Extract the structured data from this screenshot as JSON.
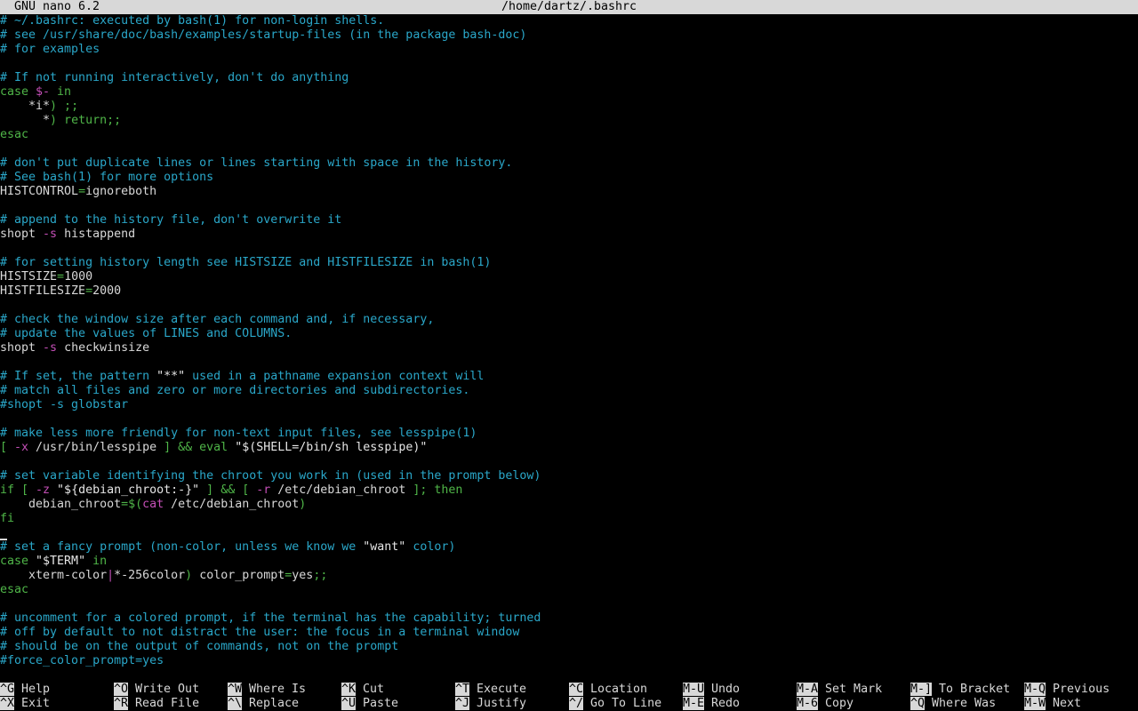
{
  "title": {
    "app": "GNU nano 6.2",
    "file": "/home/dartz/.bashrc"
  },
  "lines": [
    [
      {
        "t": "# ~/.bashrc: executed by bash(1) for non-login shells.",
        "c": "comment"
      }
    ],
    [
      {
        "t": "# see /usr/share/doc/bash/examples/startup-files (in the package bash-doc)",
        "c": "comment"
      }
    ],
    [
      {
        "t": "# for examples",
        "c": "comment"
      }
    ],
    [],
    [
      {
        "t": "# If not running interactively, don't do anything",
        "c": "comment"
      }
    ],
    [
      {
        "t": "case ",
        "c": "kw"
      },
      {
        "t": "$-",
        "c": "flag"
      },
      {
        "t": " in",
        "c": "kw"
      }
    ],
    [
      {
        "t": "    *i*",
        "c": "var"
      },
      {
        "t": ") ;;",
        "c": "kw"
      }
    ],
    [
      {
        "t": "      *",
        "c": "var"
      },
      {
        "t": ") return;;",
        "c": "kw"
      }
    ],
    [
      {
        "t": "esac",
        "c": "kw"
      }
    ],
    [],
    [
      {
        "t": "# don't put duplicate lines or lines starting with space in the history.",
        "c": "comment"
      }
    ],
    [
      {
        "t": "# See bash(1) for more options",
        "c": "comment"
      }
    ],
    [
      {
        "t": "HISTCONTROL",
        "c": "var"
      },
      {
        "t": "=",
        "c": "op"
      },
      {
        "t": "ignoreboth",
        "c": "var"
      }
    ],
    [],
    [
      {
        "t": "# append to the history file, don't overwrite it",
        "c": "comment"
      }
    ],
    [
      {
        "t": "shopt ",
        "c": "var"
      },
      {
        "t": "-s",
        "c": "flag"
      },
      {
        "t": " histappend",
        "c": "var"
      }
    ],
    [],
    [
      {
        "t": "# for setting history length see HISTSIZE and HISTFILESIZE in bash(1)",
        "c": "comment"
      }
    ],
    [
      {
        "t": "HISTSIZE",
        "c": "var"
      },
      {
        "t": "=",
        "c": "op"
      },
      {
        "t": "1000",
        "c": "var"
      }
    ],
    [
      {
        "t": "HISTFILESIZE",
        "c": "var"
      },
      {
        "t": "=",
        "c": "op"
      },
      {
        "t": "2000",
        "c": "var"
      }
    ],
    [],
    [
      {
        "t": "# check the window size after each command and, if necessary,",
        "c": "comment"
      }
    ],
    [
      {
        "t": "# update the values of LINES and COLUMNS.",
        "c": "comment"
      }
    ],
    [
      {
        "t": "shopt ",
        "c": "var"
      },
      {
        "t": "-s",
        "c": "flag"
      },
      {
        "t": " checkwinsize",
        "c": "var"
      }
    ],
    [],
    [
      {
        "t": "# If set, the pattern ",
        "c": "comment"
      },
      {
        "t": "\"**\"",
        "c": "str"
      },
      {
        "t": " used in a pathname expansion context will",
        "c": "comment"
      }
    ],
    [
      {
        "t": "# match all files and zero or more directories and subdirectories.",
        "c": "comment"
      }
    ],
    [
      {
        "t": "#shopt -s globstar",
        "c": "comment"
      }
    ],
    [],
    [
      {
        "t": "# make less more friendly for non-text input files, see lesspipe(1)",
        "c": "comment"
      }
    ],
    [
      {
        "t": "[ ",
        "c": "kw"
      },
      {
        "t": "-x",
        "c": "flag"
      },
      {
        "t": " /usr/bin/lesspipe ",
        "c": "var"
      },
      {
        "t": "] && eval ",
        "c": "kw"
      },
      {
        "t": "\"$(SHELL=/bin/sh lesspipe)\"",
        "c": "str"
      }
    ],
    [],
    [
      {
        "t": "# set variable identifying the chroot you work in (used in the prompt below)",
        "c": "comment"
      }
    ],
    [
      {
        "t": "if [ ",
        "c": "kw"
      },
      {
        "t": "-z",
        "c": "flag"
      },
      {
        "t": " \"${debian_chroot:-}\"",
        "c": "str"
      },
      {
        "t": " ] && [ ",
        "c": "kw"
      },
      {
        "t": "-r",
        "c": "flag"
      },
      {
        "t": " /etc/debian_chroot ",
        "c": "var"
      },
      {
        "t": "]; then",
        "c": "kw"
      }
    ],
    [
      {
        "t": "    debian_chroot",
        "c": "var"
      },
      {
        "t": "=$(",
        "c": "op"
      },
      {
        "t": "cat",
        "c": "flag"
      },
      {
        "t": " /etc/debian_chroot",
        "c": "var"
      },
      {
        "t": ")",
        "c": "op"
      }
    ],
    [
      {
        "t": "fi",
        "c": "kw"
      }
    ],
    [
      {
        "t": "",
        "c": "cursor"
      }
    ],
    [
      {
        "t": "# set a fancy prompt (non-color, unless we know we ",
        "c": "comment"
      },
      {
        "t": "\"want\"",
        "c": "str"
      },
      {
        "t": " color)",
        "c": "comment"
      }
    ],
    [
      {
        "t": "case ",
        "c": "kw"
      },
      {
        "t": "\"$TERM\"",
        "c": "str"
      },
      {
        "t": " in",
        "c": "kw"
      }
    ],
    [
      {
        "t": "    xterm-color",
        "c": "var"
      },
      {
        "t": "|",
        "c": "flag"
      },
      {
        "t": "*-256color",
        "c": "var"
      },
      {
        "t": ") ",
        "c": "kw"
      },
      {
        "t": "color_prompt",
        "c": "var"
      },
      {
        "t": "=",
        "c": "op"
      },
      {
        "t": "yes",
        "c": "var"
      },
      {
        "t": ";;",
        "c": "kw"
      }
    ],
    [
      {
        "t": "esac",
        "c": "kw"
      }
    ],
    [],
    [
      {
        "t": "# uncomment for a colored prompt, if the terminal has the capability; turned",
        "c": "comment"
      }
    ],
    [
      {
        "t": "# off by default to not distract the user: the focus in a terminal window",
        "c": "comment"
      }
    ],
    [
      {
        "t": "# should be on the output of commands, not on the prompt",
        "c": "comment"
      }
    ],
    [
      {
        "t": "#force_color_prompt=yes",
        "c": "comment"
      }
    ]
  ],
  "shortcuts": [
    {
      "key": "^G",
      "label": "Help"
    },
    {
      "key": "^X",
      "label": "Exit"
    },
    {
      "key": "^O",
      "label": "Write Out"
    },
    {
      "key": "^R",
      "label": "Read File"
    },
    {
      "key": "^W",
      "label": "Where Is"
    },
    {
      "key": "^\\",
      "label": "Replace"
    },
    {
      "key": "^K",
      "label": "Cut"
    },
    {
      "key": "^U",
      "label": "Paste"
    },
    {
      "key": "^T",
      "label": "Execute"
    },
    {
      "key": "^J",
      "label": "Justify"
    },
    {
      "key": "^C",
      "label": "Location"
    },
    {
      "key": "^/",
      "label": "Go To Line"
    },
    {
      "key": "M-U",
      "label": "Undo"
    },
    {
      "key": "M-E",
      "label": "Redo"
    },
    {
      "key": "M-A",
      "label": "Set Mark"
    },
    {
      "key": "M-6",
      "label": "Copy"
    },
    {
      "key": "M-]",
      "label": "To Bracket"
    },
    {
      "key": "^Q",
      "label": "Where Was"
    },
    {
      "key": "M-Q",
      "label": "Previous"
    },
    {
      "key": "M-W",
      "label": "Next"
    }
  ],
  "colors": {
    "comment": "#2aa7c9",
    "keyword": "#4fb548",
    "flag": "#c44fb7",
    "text": "#d8d8d8",
    "background": "#000000",
    "titlebar": "#d8d8d8"
  }
}
